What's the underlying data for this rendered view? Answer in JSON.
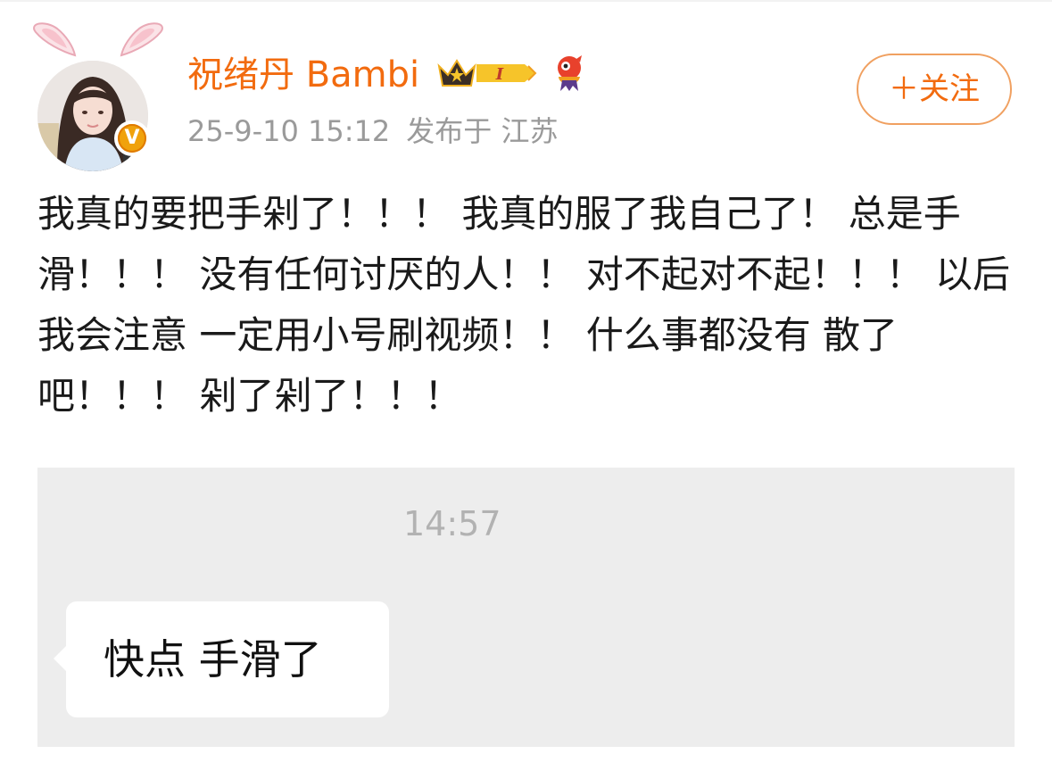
{
  "post": {
    "author": {
      "name": "祝绪丹 Bambi",
      "verified_badge": "V",
      "avatar_icon": "avatar-photo",
      "ears_icon": "bunny-ears-icon",
      "membership_icon": "crown-level-icon",
      "membership_level": "I",
      "mascot_icon": "mascot-icon"
    },
    "timestamp": "25-9-10 15:12",
    "location": "发布于 江苏",
    "follow_label": "＋关注",
    "content": "我真的要把手剁了！！！ 我真的服了我自己了！ 总是手滑！！！ 没有任何讨厌的人！！ 对不起对不起！！！ 以后我会注意 一定用小号刷视频！！ 什么事都没有 散了吧！！！ 剁了剁了！！！"
  },
  "attachment": {
    "chat_time": "14:57",
    "message": "快点 手滑了"
  },
  "colors": {
    "accent": "#f26b0f",
    "meta_gray": "#9a9a9a",
    "chat_bg": "#ededed",
    "verified": "#f0a20c"
  }
}
